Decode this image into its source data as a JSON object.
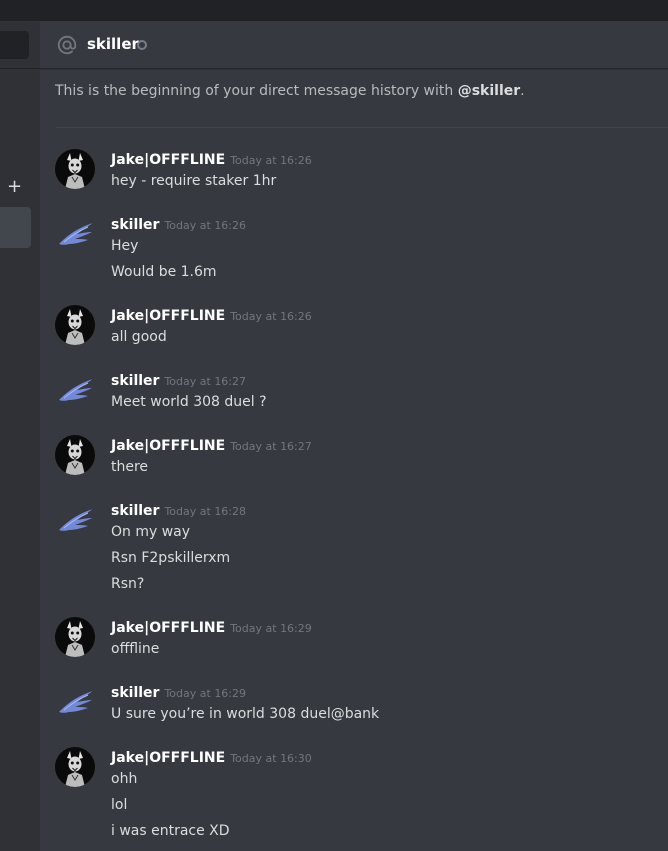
{
  "header": {
    "title": "skiller"
  },
  "intro": {
    "prefix": "This is the beginning of your direct message history with ",
    "mention": "@skiller",
    "suffix": "."
  },
  "sidebar": {
    "add_label": "+"
  },
  "users": {
    "jake": {
      "name": "Jake|OFFFLINE",
      "avatar": "horned-skull-avatar"
    },
    "skiller": {
      "name": "skiller",
      "avatar": "blue-wing-avatar"
    }
  },
  "messages": [
    {
      "author": "Jake|OFFFLINE",
      "time": "Today at 16:26",
      "lines": [
        "hey - require staker 1hr"
      ]
    },
    {
      "author": "skiller",
      "time": "Today at 16:26",
      "lines": [
        "Hey",
        "Would be 1.6m"
      ]
    },
    {
      "author": "Jake|OFFFLINE",
      "time": "Today at 16:26",
      "lines": [
        "all good"
      ]
    },
    {
      "author": "skiller",
      "time": "Today at 16:27",
      "lines": [
        "Meet world 308 duel ?"
      ]
    },
    {
      "author": "Jake|OFFFLINE",
      "time": "Today at 16:27",
      "lines": [
        "there"
      ]
    },
    {
      "author": "skiller",
      "time": "Today at 16:28",
      "lines": [
        "On my way",
        "Rsn F2pskillerxm",
        "Rsn?"
      ]
    },
    {
      "author": "Jake|OFFFLINE",
      "time": "Today at 16:29",
      "lines": [
        "offfline"
      ]
    },
    {
      "author": "skiller",
      "time": "Today at 16:29",
      "lines": [
        "U sure you’re in world 308 duel@bank"
      ]
    },
    {
      "author": "Jake|OFFFLINE",
      "time": "Today at 16:30",
      "lines": [
        "ohh",
        "lol",
        "i was entrace XD"
      ]
    }
  ]
}
